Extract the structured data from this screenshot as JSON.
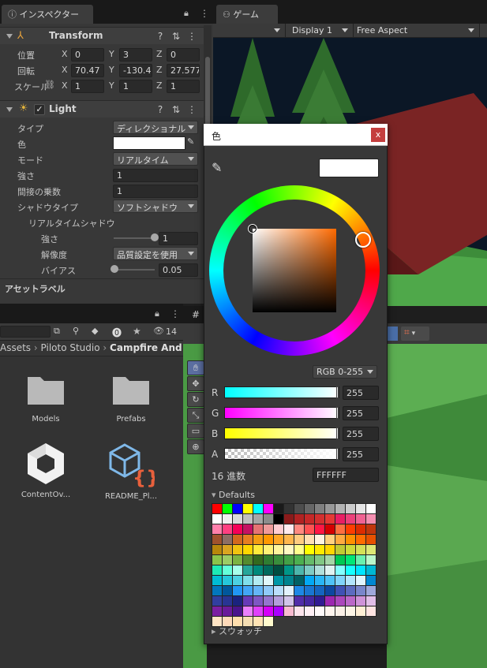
{
  "inspector": {
    "tab_label": "インスペクター",
    "transform": {
      "title": "Transform",
      "position_label": "位置",
      "rotation_label": "回転",
      "scale_label": "スケール",
      "position": {
        "x": "0",
        "y": "3",
        "z": "0"
      },
      "rotation": {
        "x": "70.47",
        "y": "-130.4",
        "z": "27.577"
      },
      "scale": {
        "x": "1",
        "y": "1",
        "z": "1"
      },
      "axis_x": "X",
      "axis_y": "Y",
      "axis_z": "Z"
    },
    "light": {
      "title": "Light",
      "type_label": "タイプ",
      "type_value": "ディレクショナル",
      "color_label": "色",
      "mode_label": "モード",
      "mode_value": "リアルタイム",
      "intensity_label": "強さ",
      "intensity_value": "1",
      "indirect_label": "間接の乗数",
      "indirect_value": "1",
      "shadow_type_label": "シャドウタイプ",
      "shadow_type_value": "ソフトシャドウ",
      "realtime_shadow_label": "リアルタイムシャドウ",
      "strength_label": "強さ",
      "strength_value": "1",
      "strength_level": 1.0,
      "resolution_label": "解像度",
      "resolution_value": "品質設定を使用",
      "bias_label": "バイアス",
      "bias_value": "0.05",
      "bias_level": 0.025
    },
    "asset_labels": "アセットラベル"
  },
  "game": {
    "tab_label": "ゲーム",
    "display": "Display 1",
    "aspect": "Free Aspect"
  },
  "project": {
    "breadcrumb": [
      "Assets",
      "Piloto Studio",
      "Campfire And"
    ],
    "hidden_count": "14",
    "assets": [
      {
        "name": "Models"
      },
      {
        "name": "Prefabs"
      },
      {
        "name": "ContentOv..."
      },
      {
        "name": "README_Pl..."
      }
    ]
  },
  "color_picker": {
    "title": "色",
    "close": "x",
    "mode": "RGB 0-255",
    "r_label": "R",
    "g_label": "G",
    "b_label": "B",
    "a_label": "A",
    "r": "255",
    "g": "255",
    "b": "255",
    "a": "255",
    "hex_label": "16 進数",
    "hex": "FFFFFF",
    "defaults_label": "Defaults",
    "swatches_label": "スウォッチ",
    "current_color": "#ffffff",
    "swatches": [
      "#ff0000",
      "#00ff00",
      "#0000ff",
      "#ffff00",
      "#00ffff",
      "#ff00ff",
      "#1a1a1a",
      "#333333",
      "#4d4d4d",
      "#666666",
      "#808080",
      "#999999",
      "#b3b3b3",
      "#cccccc",
      "#e6e6e6",
      "#ffffff",
      "#ffffff",
      "#f0f0f0",
      "#d9d9d9",
      "#c0c0c0",
      "#a6a6a6",
      "#8c8c8c",
      "#000000",
      "#8b1a1a",
      "#b22222",
      "#c62828",
      "#d32f2f",
      "#e53935",
      "#e91e63",
      "#ec407a",
      "#f06292",
      "#f48fb1",
      "#ff80ab",
      "#ff4081",
      "#f50057",
      "#c51162",
      "#e57373",
      "#ef9a9a",
      "#ffcdd2",
      "#ffebee",
      "#ff8a80",
      "#ff5252",
      "#ff1744",
      "#d50000",
      "#ff6e40",
      "#ff3d00",
      "#dd2c00",
      "#bf360c",
      "#a0522d",
      "#8d6e63",
      "#d2691e",
      "#e67e22",
      "#f39c12",
      "#ff9800",
      "#ffa726",
      "#ffb74d",
      "#ffcc80",
      "#ffe0b2",
      "#fff3e0",
      "#ffd180",
      "#ffab40",
      "#ff9100",
      "#ff6d00",
      "#e65100",
      "#b8860b",
      "#daa520",
      "#f1c40f",
      "#ffd700",
      "#ffeb3b",
      "#fff176",
      "#fff59d",
      "#fff9c4",
      "#ffff8d",
      "#ffff00",
      "#ffea00",
      "#ffd600",
      "#c0ca33",
      "#cddc39",
      "#d4e157",
      "#dce775",
      "#8bc34a",
      "#9ccc65",
      "#7cb342",
      "#558b2f",
      "#33691e",
      "#2e7d32",
      "#388e3c",
      "#43a047",
      "#4caf50",
      "#66bb6a",
      "#81c784",
      "#a5d6a7",
      "#00c853",
      "#00e676",
      "#69f0ae",
      "#b9f6ca",
      "#1de9b6",
      "#64ffda",
      "#a7ffeb",
      "#26a69a",
      "#00897b",
      "#00695c",
      "#004d40",
      "#009688",
      "#4db6ac",
      "#80cbc4",
      "#b2dfdb",
      "#e0f2f1",
      "#84ffff",
      "#18ffff",
      "#00e5ff",
      "#00b8d4",
      "#00bcd4",
      "#26c6da",
      "#4dd0e1",
      "#80deea",
      "#b2ebf2",
      "#e0f7fa",
      "#0097a7",
      "#00838f",
      "#006064",
      "#03a9f4",
      "#29b6f6",
      "#4fc3f7",
      "#81d4fa",
      "#b3e5fc",
      "#e1f5fe",
      "#0288d1",
      "#0277bd",
      "#01579b",
      "#2196f3",
      "#42a5f5",
      "#64b5f6",
      "#90caf9",
      "#bbdefb",
      "#e3f2fd",
      "#1e88e5",
      "#1976d2",
      "#1565c0",
      "#0d47a1",
      "#3f51b5",
      "#5c6bc0",
      "#7986cb",
      "#9fa8da",
      "#303f9f",
      "#283593",
      "#1a237e",
      "#673ab7",
      "#7e57c2",
      "#9575cd",
      "#b39ddb",
      "#d1c4e9",
      "#512da8",
      "#4527a0",
      "#311b92",
      "#9c27b0",
      "#ab47bc",
      "#ba68c8",
      "#ce93d8",
      "#e1bee7",
      "#7b1fa2",
      "#6a1b9a",
      "#4a148c",
      "#ea80fc",
      "#e040fb",
      "#d500f9",
      "#aa00ff",
      "#f8bbd0",
      "#fce4ec",
      "#fff0f5",
      "#fffafa",
      "#fff5ee",
      "#faf0e6",
      "#fdf5e6",
      "#ffefd5",
      "#ffe4e1",
      "#ffe4c4",
      "#ffdab9",
      "#ffdead",
      "#f5deb3",
      "#ffe4b5",
      "#fffacd"
    ]
  }
}
